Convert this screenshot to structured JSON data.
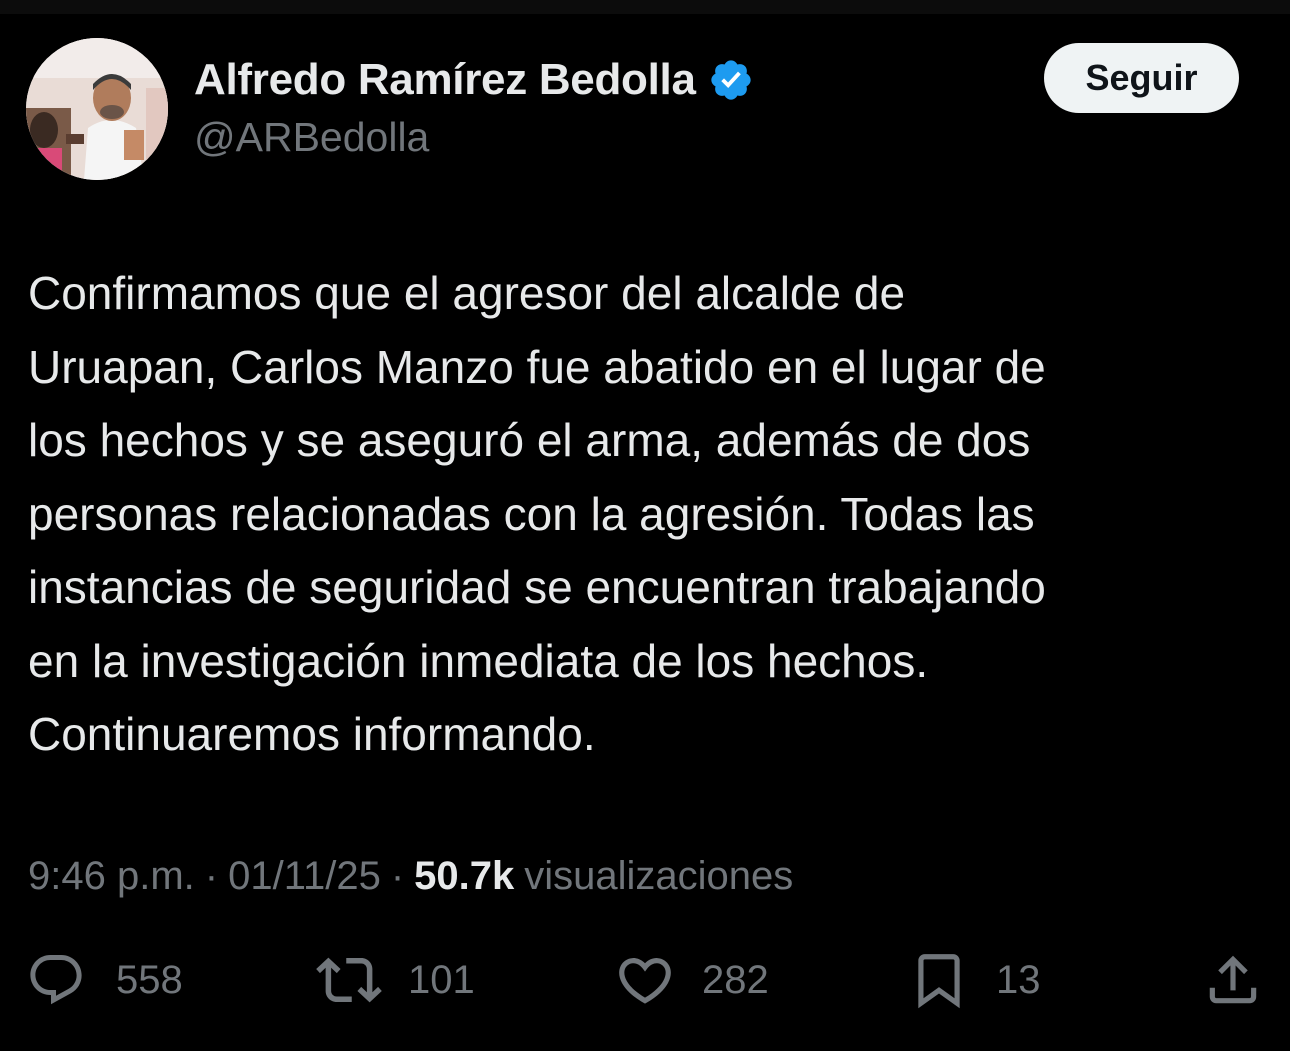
{
  "profile": {
    "display_name": "Alfredo Ramírez Bedolla",
    "handle": "@ARBedolla",
    "verified": true
  },
  "follow_button": {
    "label": "Seguir"
  },
  "tweet": {
    "lines": [
      "Confirmamos que el agresor del alcalde de",
      "Uruapan, Carlos Manzo fue abatido en el lugar de",
      "los hechos y se aseguró el arma, además de dos",
      "personas relacionadas con la agresión. Todas las",
      "instancias de seguridad se encuentran trabajando",
      "en la investigación inmediata de los hechos.",
      "Continuaremos informando."
    ]
  },
  "meta": {
    "time": "9:46 p.m.",
    "date": "01/11/25",
    "separator": "·",
    "views_count": "50.7k",
    "views_label": "visualizaciones"
  },
  "actions": {
    "replies": "558",
    "reposts": "101",
    "likes": "282",
    "bookmarks": "13"
  },
  "colors": {
    "background": "#000000",
    "text_primary": "#e7e9ea",
    "text_secondary": "#71767b",
    "verified_badge": "#1d9bf0",
    "follow_button_bg": "#eff3f4"
  }
}
